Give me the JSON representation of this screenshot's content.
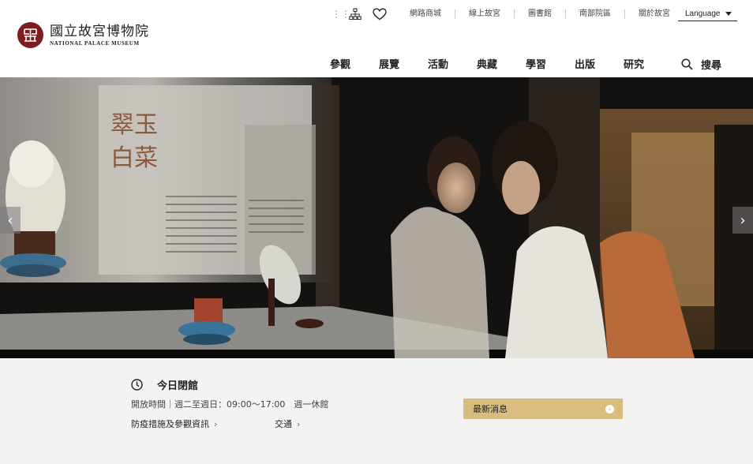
{
  "header": {
    "logo_zh": "國立故宮博物院",
    "logo_en": "NATIONAL PALACE MUSEUM",
    "util_links": [
      "網路商城",
      "線上故宮",
      "圖書館",
      "南部院區",
      "關於故宮"
    ],
    "language_label": "Language",
    "nav": [
      "參觀",
      "展覽",
      "活動",
      "典藏",
      "學習",
      "出版",
      "研究"
    ],
    "search_label": "搜尋"
  },
  "hero": {
    "sign_line1": "翠玉",
    "sign_line2": "白菜",
    "prev_symbol": "‹",
    "next_symbol": "›"
  },
  "info": {
    "today_label": "今日閉館",
    "hours": "開放時間｜週二至週日：09:00～17:00　週一休館",
    "link_covid": "防疫措施及參觀資訊",
    "link_transport": "交通",
    "chevron": "›",
    "news_label": "最新消息",
    "news_arrow": "›"
  },
  "colors": {
    "brand_red": "#7d1d1d",
    "gold": "#d9bd7f",
    "info_bg": "#f3f3f2"
  }
}
